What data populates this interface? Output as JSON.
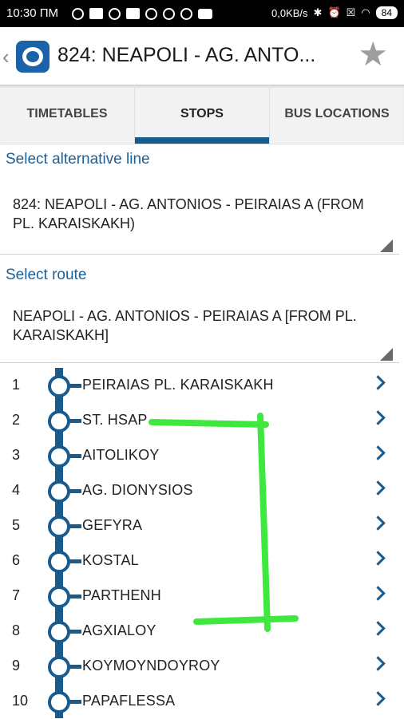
{
  "status_bar": {
    "time": "10:30 ПМ",
    "network_speed": "0,0KB/s",
    "battery_level": "84"
  },
  "header": {
    "back_icon": "chevron-left-icon",
    "logo_icon": "oasa-logo-icon",
    "title": "824: NEAPOLI - AG. ANTO...",
    "favorite_icon": "star-icon"
  },
  "tabs": [
    {
      "label": "TIMETABLES",
      "active": false
    },
    {
      "label": "STOPS",
      "active": true
    },
    {
      "label": "BUS LOCATIONS",
      "active": false
    }
  ],
  "line_select": {
    "label": "Select alternative line",
    "value": "824: NEAPOLI - AG. ANTONIOS - PEIRAIAS A (FROM PL. KARAISKAKH)"
  },
  "route_select": {
    "label": "Select route",
    "value": "NEAPOLI - AG. ANTONIOS - PEIRAIAS A [FROM PL. KARAISKAKH]"
  },
  "stops": [
    {
      "num": "1",
      "name": "PEIRAIAS PL. KARAISKAKH"
    },
    {
      "num": "2",
      "name": "ST. HSAP"
    },
    {
      "num": "3",
      "name": "AITOLIKOY"
    },
    {
      "num": "4",
      "name": "AG. DIONYSIOS"
    },
    {
      "num": "5",
      "name": "GEFYRA"
    },
    {
      "num": "6",
      "name": "KOSTAL"
    },
    {
      "num": "7",
      "name": "PARTHENH"
    },
    {
      "num": "8",
      "name": "AGXIALOY"
    },
    {
      "num": "9",
      "name": "KOYMOYNDOYROY"
    },
    {
      "num": "10",
      "name": "PAPAFLESSA"
    }
  ],
  "colors": {
    "accent": "#1a5b8e",
    "label_blue": "#1e6096",
    "annotation_green": "#3ee83e"
  }
}
